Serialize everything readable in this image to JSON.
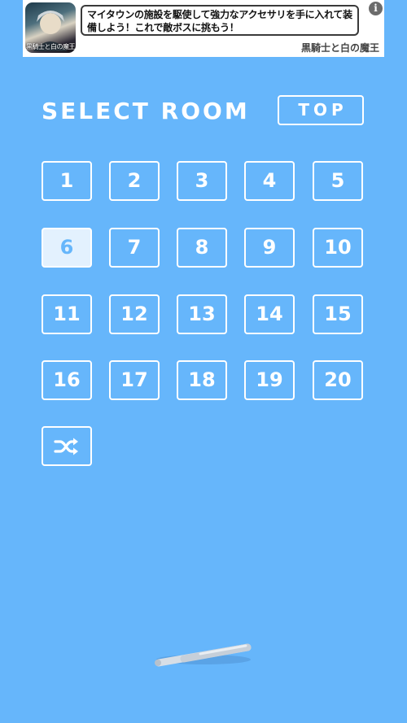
{
  "ad": {
    "message": "マイタウンの施設を駆使して強力なアクセサリを手に入れて装備しよう！これで敵ボスに挑もう！",
    "brand": "黒騎士と白の魔王",
    "thumb_caption": "黒騎士と白の魔王",
    "info_glyph": "i"
  },
  "header": {
    "title": "SELECT ROOM",
    "top_label": "TOP"
  },
  "rooms": [
    "1",
    "2",
    "3",
    "4",
    "5",
    "6",
    "7",
    "8",
    "9",
    "10",
    "11",
    "12",
    "13",
    "14",
    "15",
    "16",
    "17",
    "18",
    "19",
    "20"
  ],
  "current_room": "6",
  "colors": {
    "background": "#66b6fb",
    "tile_border": "#ffffff",
    "current_tile_fill": "#e3f1fe"
  }
}
